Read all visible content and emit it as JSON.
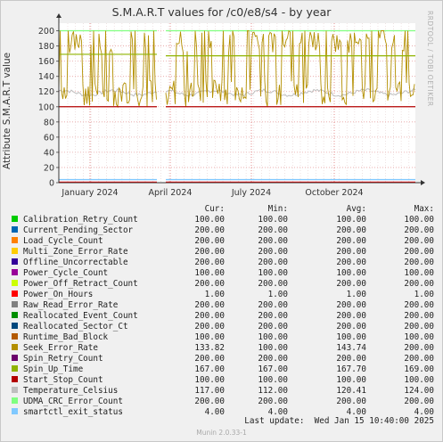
{
  "title": "S.M.A.R.T values for /c0/e8/s4 - by year",
  "ylabel": "Attribute S.M.A.R.T value",
  "side_text": "RRDTOOL / TOBI OETIKER",
  "footer": "Munin 2.0.33-1",
  "last_update_label": "Last update:",
  "last_update_value": "Wed Jan 15 10:40:00 2025",
  "headers": {
    "cur": "Cur:",
    "min": "Min:",
    "avg": "Avg:",
    "max": "Max:"
  },
  "chart_data": {
    "type": "line",
    "ylim": [
      0,
      210
    ],
    "yticks": [
      0,
      20,
      40,
      60,
      80,
      100,
      120,
      140,
      160,
      180,
      200
    ],
    "xticks": [
      "January 2024",
      "April 2024",
      "July 2024",
      "October 2024"
    ],
    "grid": true,
    "series": [
      {
        "name": "Calibration_Retry_Count",
        "color": "#00cc00",
        "cur": "100.00",
        "min": "100.00",
        "avg": "100.00",
        "max": "100.00"
      },
      {
        "name": "Current_Pending_Sector",
        "color": "#0066b3",
        "cur": "200.00",
        "min": "200.00",
        "avg": "200.00",
        "max": "200.00"
      },
      {
        "name": "Load_Cycle_Count",
        "color": "#ff8000",
        "cur": "200.00",
        "min": "200.00",
        "avg": "200.00",
        "max": "200.00"
      },
      {
        "name": "Multi_Zone_Error_Rate",
        "color": "#ffcc00",
        "cur": "200.00",
        "min": "200.00",
        "avg": "200.00",
        "max": "200.00"
      },
      {
        "name": "Offline_Uncorrectable",
        "color": "#330099",
        "cur": "200.00",
        "min": "200.00",
        "avg": "200.00",
        "max": "200.00"
      },
      {
        "name": "Power_Cycle_Count",
        "color": "#990099",
        "cur": "100.00",
        "min": "100.00",
        "avg": "100.00",
        "max": "100.00"
      },
      {
        "name": "Power_Off_Retract_Count",
        "color": "#ccff00",
        "cur": "200.00",
        "min": "200.00",
        "avg": "200.00",
        "max": "200.00"
      },
      {
        "name": "Power_On_Hours",
        "color": "#ff0000",
        "cur": "1.00",
        "min": "1.00",
        "avg": "1.00",
        "max": "1.00"
      },
      {
        "name": "Raw_Read_Error_Rate",
        "color": "#808080",
        "cur": "200.00",
        "min": "200.00",
        "avg": "200.00",
        "max": "200.00"
      },
      {
        "name": "Reallocated_Event_Count",
        "color": "#008f00",
        "cur": "200.00",
        "min": "200.00",
        "avg": "200.00",
        "max": "200.00"
      },
      {
        "name": "Reallocated_Sector_Ct",
        "color": "#00487d",
        "cur": "200.00",
        "min": "200.00",
        "avg": "200.00",
        "max": "200.00"
      },
      {
        "name": "Runtime_Bad_Block",
        "color": "#b35a00",
        "cur": "100.00",
        "min": "100.00",
        "avg": "100.00",
        "max": "100.00"
      },
      {
        "name": "Seek_Error_Rate",
        "color": "#b38f00",
        "cur": "133.82",
        "min": "100.00",
        "avg": "143.74",
        "max": "200.00"
      },
      {
        "name": "Spin_Retry_Count",
        "color": "#6b006b",
        "cur": "200.00",
        "min": "200.00",
        "avg": "200.00",
        "max": "200.00"
      },
      {
        "name": "Spin_Up_Time",
        "color": "#8fb300",
        "cur": "167.00",
        "min": "167.00",
        "avg": "167.70",
        "max": "169.00"
      },
      {
        "name": "Start_Stop_Count",
        "color": "#b30000",
        "cur": "100.00",
        "min": "100.00",
        "avg": "100.00",
        "max": "100.00"
      },
      {
        "name": "Temperature_Celsius",
        "color": "#bebebe",
        "cur": "117.00",
        "min": "112.00",
        "avg": "120.41",
        "max": "124.00"
      },
      {
        "name": "UDMA_CRC_Error_Count",
        "color": "#80ff80",
        "cur": "200.00",
        "min": "200.00",
        "avg": "200.00",
        "max": "200.00"
      },
      {
        "name": "smartctl_exit_status",
        "color": "#80c9ff",
        "cur": "4.00",
        "min": "4.00",
        "avg": "4.00",
        "max": "4.00"
      }
    ]
  }
}
